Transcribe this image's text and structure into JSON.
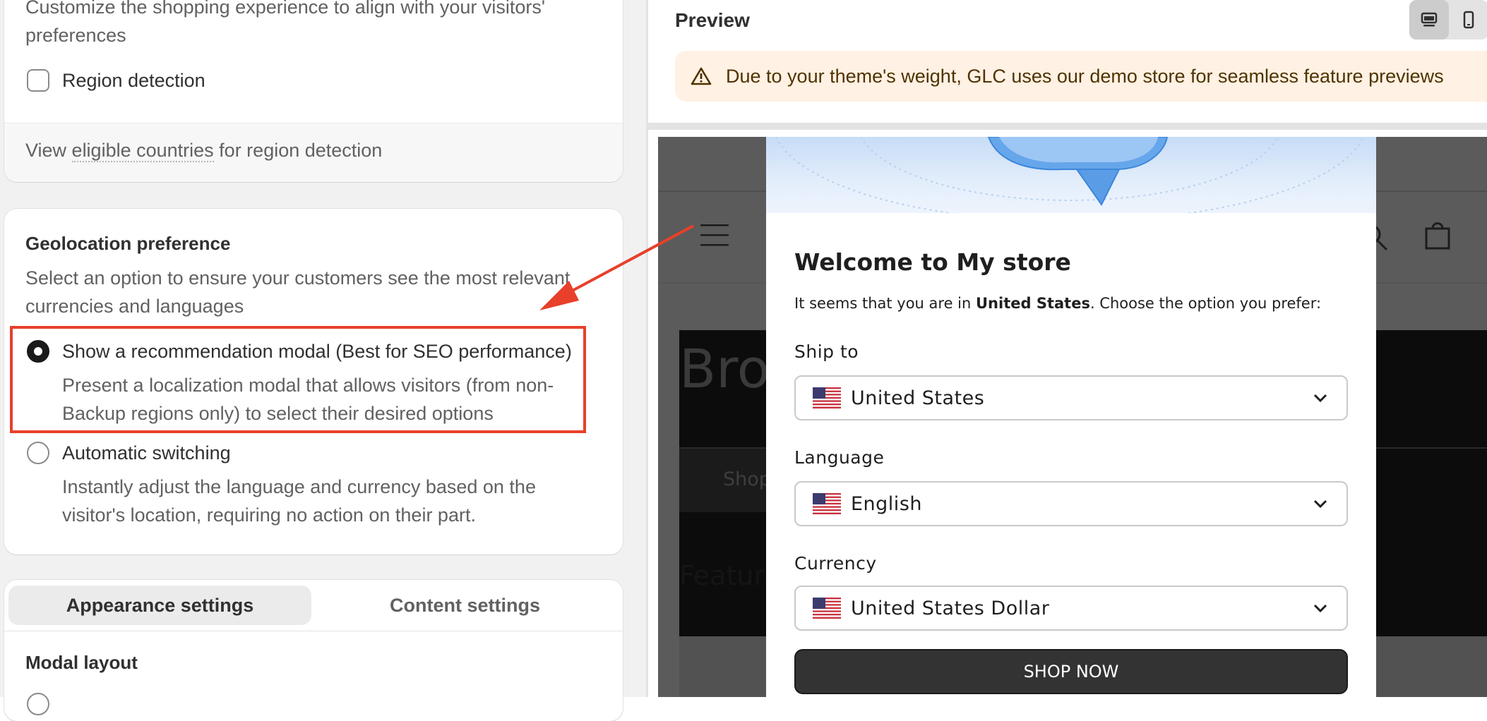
{
  "left": {
    "region_card": {
      "desc": "Customize the shopping experience to align with your visitors' preferences",
      "checkbox_label": "Region detection",
      "footer_link_pre": "View ",
      "footer_link": "eligible countries",
      "footer_link_post": " for region detection"
    },
    "geo_card": {
      "title": "Geolocation preference",
      "desc": "Select an option to ensure your customers see the most relevant currencies and languages",
      "options": [
        {
          "label": "Show a recommendation modal (Best for SEO performance)",
          "desc": "Present a localization modal that allows visitors (from non-Backup regions only) to select their desired options",
          "selected": true
        },
        {
          "label": "Automatic switching",
          "desc": "Instantly adjust the language and currency based on the visitor's location, requiring no action on their part.",
          "selected": false
        }
      ]
    },
    "settings_card": {
      "tabs": [
        "Appearance settings",
        "Content settings"
      ],
      "active_tab": "Appearance settings",
      "section_title": "Modal layout"
    }
  },
  "preview": {
    "title": "Preview",
    "device_icons": [
      "desktop-icon",
      "mobile-icon"
    ],
    "banner_text": "Due to your theme's weight, GLC uses our demo store for seamless feature previews",
    "banner_icon": "warning-icon",
    "store_bg": {
      "hero_text": "Bro",
      "button_text": "Shop",
      "featured_text": "Feature"
    },
    "modal": {
      "title": "Welcome to My store",
      "subtitle_pre": "It seems that you are in ",
      "subtitle_country": "United States",
      "subtitle_post": ". Choose the option you prefer:",
      "ship_to_label": "Ship to",
      "ship_to_value": "United States",
      "language_label": "Language",
      "language_value": "English",
      "currency_label": "Currency",
      "currency_value": "United States Dollar",
      "button": "SHOP NOW"
    }
  },
  "colors": {
    "annotation_red": "#e8402a",
    "banner_bg": "#fff1e3",
    "modal_button": "#333333"
  }
}
